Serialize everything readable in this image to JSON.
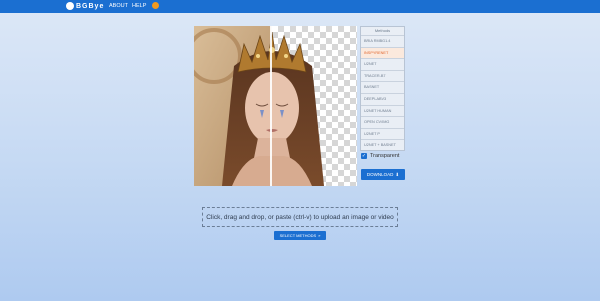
{
  "header": {
    "brand": "BGBye",
    "nav": {
      "about": "ABOUT",
      "help": "HELP"
    },
    "accent_color": "#1b6fd1",
    "help_icon": "orange-circle-icon"
  },
  "methods": {
    "title": "Methods",
    "items": [
      {
        "label": "BRIA RMBG1.4",
        "active": false
      },
      {
        "label": "INSPYRENET",
        "active": true
      },
      {
        "label": "U2NET",
        "active": false
      },
      {
        "label": "TRACER-B7",
        "active": false
      },
      {
        "label": "BASNET",
        "active": false
      },
      {
        "label": "DEEPLABV3",
        "active": false
      },
      {
        "label": "U2NET HUMAN",
        "active": false
      },
      {
        "label": "OPEN CV/IMG",
        "active": false
      },
      {
        "label": "U2NET P",
        "active": false
      },
      {
        "label": "U2NET + BASNET",
        "active": false
      }
    ],
    "active_color": "#e1652b"
  },
  "transparent": {
    "label": "Transparent",
    "checked": true
  },
  "download": {
    "label": "DOWNLOAD",
    "icon": "download-icon"
  },
  "upload": {
    "text": "Click, drag and drop, or paste (ctrl-v) to upload an image or video"
  },
  "select_methods": {
    "label": "SELECT METHODS",
    "icon": "double-chevron-icon"
  },
  "preview": {
    "split_fraction": 0.47
  }
}
